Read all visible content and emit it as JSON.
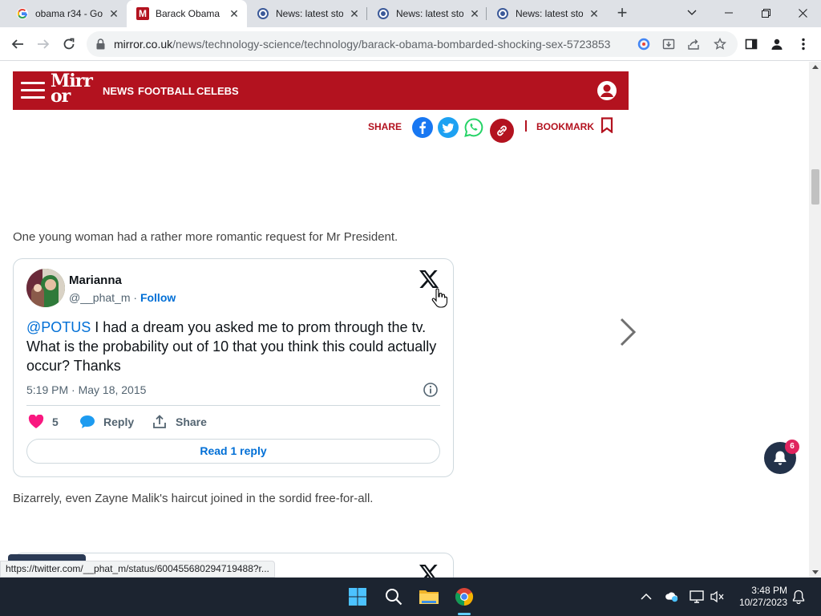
{
  "browser": {
    "tabs": [
      {
        "title": "obama r34 - Go",
        "favicon": "google-icon",
        "active": false
      },
      {
        "title": "Barack Obama I",
        "favicon": "mirror-icon",
        "active": true
      },
      {
        "title": "News: latest sto",
        "favicon": "news-icon",
        "active": false
      },
      {
        "title": "News: latest sto",
        "favicon": "news-icon",
        "active": false
      },
      {
        "title": "News: latest sto",
        "favicon": "news-icon",
        "active": false
      }
    ],
    "url": {
      "domain": "mirror.co.uk",
      "path": "/news/technology-science/technology/barack-obama-bombarded-shocking-sex-5723853"
    }
  },
  "site": {
    "logo_top": "Mirr",
    "logo_bottom": "or",
    "nav": [
      "NEWS",
      "FOOTBALL",
      "CELEBS"
    ],
    "brand_color": "#b3121f",
    "share_label": "SHARE",
    "bookmark_label": "BOOKMARK"
  },
  "article": {
    "para1": "One young woman had a rather more romantic request for Mr President.",
    "para2": "Bizarrely, even Zayne Malik's haircut joined in the sordid free-for-all."
  },
  "tweet": {
    "name": "Marianna",
    "handle": "@__phat_m",
    "separator": " · ",
    "follow": "Follow",
    "mention": "@POTUS",
    "text": " I had a dream you asked me to prom through the tv. What is the probability out of 10 that you think this could actually occur? Thanks",
    "date": "5:19 PM · May 18, 2015",
    "likes": "5",
    "reply_label": "Reply",
    "share_label": "Share",
    "read_replies": "Read 1 reply"
  },
  "notifications": {
    "count": "6"
  },
  "status_url": "https://twitter.com/__phat_m/status/600455680294719488?r...",
  "taskbar": {
    "time": "3:48 PM",
    "date": "10/27/2023"
  }
}
